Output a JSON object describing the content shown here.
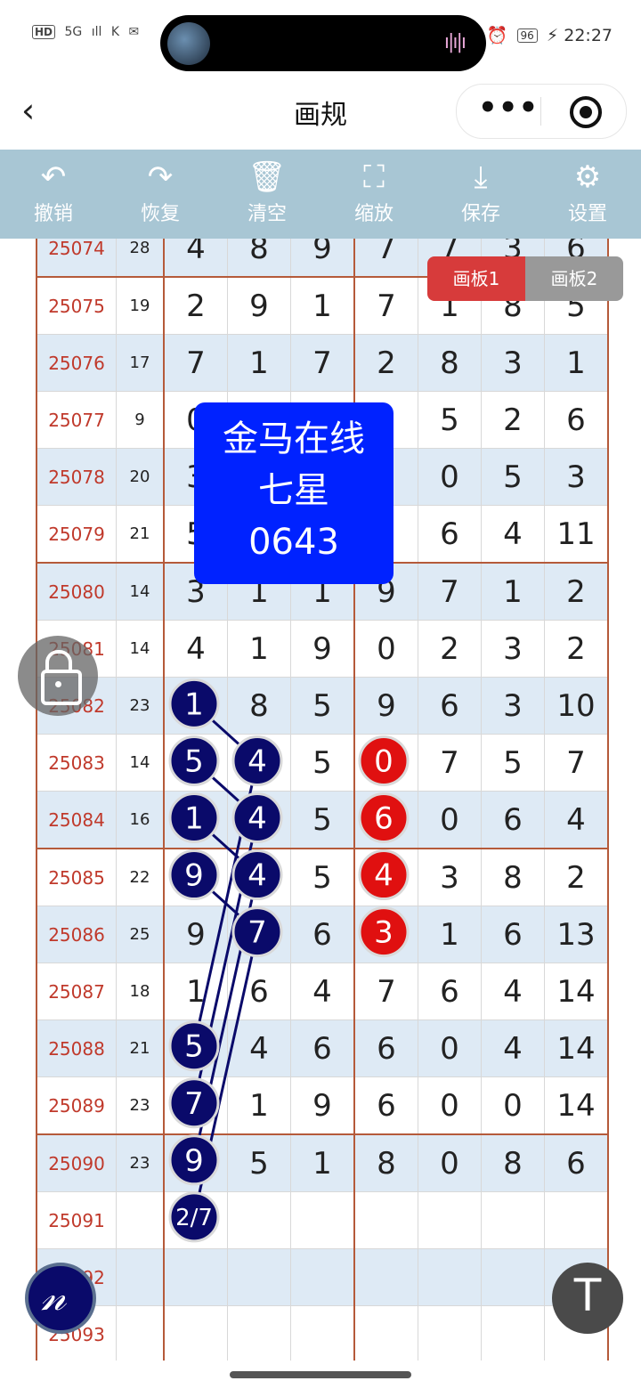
{
  "status": {
    "left": [
      "HD",
      "5G",
      "ıll",
      "K",
      "✉"
    ],
    "battery": "96",
    "time": "22:27"
  },
  "nav": {
    "back": "‹",
    "title": "画规",
    "menu_dots": "•••"
  },
  "toolbar": [
    {
      "icon": "↶",
      "label": "撤销",
      "name": "undo"
    },
    {
      "icon": "↷",
      "label": "恢复",
      "name": "redo"
    },
    {
      "icon": "🗑",
      "label": "清空",
      "name": "clear"
    },
    {
      "icon": "⛶",
      "label": "缩放",
      "name": "zoom"
    },
    {
      "icon": "⤓",
      "label": "保存",
      "name": "save"
    },
    {
      "icon": "⚙",
      "label": "设置",
      "name": "settings"
    }
  ],
  "tabs": [
    "画板1",
    "画板2"
  ],
  "overlay_text": [
    "金马在线",
    "七星",
    "0643"
  ],
  "rows": [
    {
      "id": "25074",
      "sum": "28",
      "d": [
        "4",
        "8",
        "9",
        "7",
        "7",
        "3",
        "6"
      ]
    },
    {
      "id": "25075",
      "sum": "19",
      "d": [
        "2",
        "9",
        "1",
        "7",
        "1",
        "8",
        "5"
      ]
    },
    {
      "id": "25076",
      "sum": "17",
      "d": [
        "7",
        "1",
        "7",
        "2",
        "8",
        "3",
        "1"
      ]
    },
    {
      "id": "25077",
      "sum": "9",
      "d": [
        "0",
        "",
        "",
        "",
        "5",
        "2",
        "6"
      ]
    },
    {
      "id": "25078",
      "sum": "20",
      "d": [
        "3",
        "",
        "",
        "",
        "0",
        "5",
        "3"
      ]
    },
    {
      "id": "25079",
      "sum": "21",
      "d": [
        "5",
        "",
        "",
        "",
        "6",
        "4",
        "11"
      ]
    },
    {
      "id": "25080",
      "sum": "14",
      "d": [
        "3",
        "1",
        "1",
        "9",
        "7",
        "1",
        "2"
      ]
    },
    {
      "id": "25081",
      "sum": "14",
      "d": [
        "4",
        "1",
        "9",
        "0",
        "2",
        "3",
        "2"
      ]
    },
    {
      "id": "25082",
      "sum": "23",
      "d": [
        "",
        "8",
        "5",
        "9",
        "6",
        "3",
        "10"
      ]
    },
    {
      "id": "25083",
      "sum": "14",
      "d": [
        "",
        "",
        "5",
        "",
        "7",
        "5",
        "7"
      ]
    },
    {
      "id": "25084",
      "sum": "16",
      "d": [
        "",
        "",
        "5",
        "",
        "0",
        "6",
        "4"
      ]
    },
    {
      "id": "25085",
      "sum": "22",
      "d": [
        "",
        "",
        "5",
        "",
        "3",
        "8",
        "2"
      ]
    },
    {
      "id": "25086",
      "sum": "25",
      "d": [
        "9",
        "",
        "6",
        "",
        "1",
        "6",
        "13"
      ]
    },
    {
      "id": "25087",
      "sum": "18",
      "d": [
        "1",
        "6",
        "4",
        "7",
        "6",
        "4",
        "14"
      ]
    },
    {
      "id": "25088",
      "sum": "21",
      "d": [
        "",
        "4",
        "6",
        "6",
        "0",
        "4",
        "14"
      ]
    },
    {
      "id": "25089",
      "sum": "23",
      "d": [
        "",
        "1",
        "9",
        "6",
        "0",
        "0",
        "14"
      ]
    },
    {
      "id": "25090",
      "sum": "23",
      "d": [
        "",
        "5",
        "1",
        "8",
        "0",
        "8",
        "6"
      ]
    },
    {
      "id": "25091",
      "sum": "",
      "d": [
        "",
        "",
        "",
        "",
        "",
        "",
        ""
      ]
    },
    {
      "id": "25092",
      "sum": "",
      "d": [
        "",
        "",
        "",
        "",
        "",
        "",
        ""
      ]
    },
    {
      "id": "25093",
      "sum": "",
      "d": [
        "",
        "",
        "",
        "",
        "",
        "",
        ""
      ]
    }
  ],
  "circles": [
    {
      "text": "1",
      "color": "dark",
      "row": 8,
      "col": 0
    },
    {
      "text": "5",
      "color": "dark",
      "row": 9,
      "col": 0
    },
    {
      "text": "4",
      "color": "dark",
      "row": 9,
      "col": 1
    },
    {
      "text": "0",
      "color": "red",
      "row": 9,
      "col": 3
    },
    {
      "text": "1",
      "color": "dark",
      "row": 10,
      "col": 0
    },
    {
      "text": "4",
      "color": "dark",
      "row": 10,
      "col": 1
    },
    {
      "text": "6",
      "color": "red",
      "row": 10,
      "col": 3
    },
    {
      "text": "9",
      "color": "dark",
      "row": 11,
      "col": 0
    },
    {
      "text": "4",
      "color": "dark",
      "row": 11,
      "col": 1
    },
    {
      "text": "4",
      "color": "red",
      "row": 11,
      "col": 3
    },
    {
      "text": "7",
      "color": "dark",
      "row": 12,
      "col": 1
    },
    {
      "text": "3",
      "color": "red",
      "row": 12,
      "col": 3
    },
    {
      "text": "5",
      "color": "dark",
      "row": 14,
      "col": 0
    },
    {
      "text": "7",
      "color": "dark",
      "row": 15,
      "col": 0
    },
    {
      "text": "9",
      "color": "dark",
      "row": 16,
      "col": 0
    },
    {
      "text": "2/7",
      "color": "dark",
      "row": 17,
      "col": 0
    }
  ],
  "lines": [
    {
      "from": [
        8,
        0
      ],
      "to": [
        9,
        1
      ]
    },
    {
      "from": [
        9,
        0
      ],
      "to": [
        10,
        1
      ]
    },
    {
      "from": [
        10,
        0
      ],
      "to": [
        11,
        1
      ]
    },
    {
      "from": [
        11,
        0
      ],
      "to": [
        12,
        1
      ]
    },
    {
      "from": [
        9,
        1
      ],
      "to": [
        14,
        0
      ]
    },
    {
      "from": [
        10,
        1
      ],
      "to": [
        15,
        0
      ]
    },
    {
      "from": [
        11,
        1
      ],
      "to": [
        16,
        0
      ]
    },
    {
      "from": [
        12,
        1
      ],
      "to": [
        17,
        0
      ]
    }
  ],
  "colors": {
    "accent_red": "#e01010",
    "ball_dark": "#0a0a6a",
    "overlay_blue": "#0022ff",
    "toolbar": "#a8c6d4"
  },
  "top_button": "T"
}
